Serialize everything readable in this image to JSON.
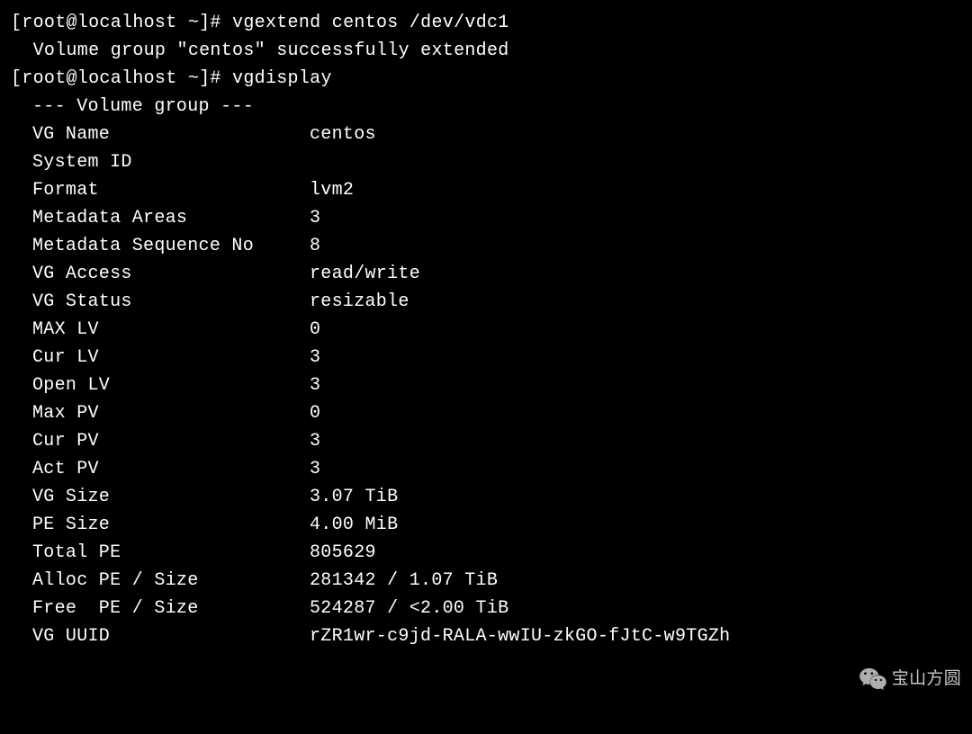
{
  "prompt1": "[root@localhost ~]# ",
  "command1": "vgextend centos /dev/vdc1",
  "output1": "  Volume group \"centos\" successfully extended",
  "prompt2": "[root@localhost ~]# ",
  "command2": "vgdisplay",
  "group_header": "--- Volume group ---",
  "kv": [
    {
      "k": "VG Name",
      "v": "centos"
    },
    {
      "k": "System ID",
      "v": ""
    },
    {
      "k": "Format",
      "v": "lvm2"
    },
    {
      "k": "Metadata Areas",
      "v": "3"
    },
    {
      "k": "Metadata Sequence No",
      "v": "8"
    },
    {
      "k": "VG Access",
      "v": "read/write"
    },
    {
      "k": "VG Status",
      "v": "resizable"
    },
    {
      "k": "MAX LV",
      "v": "0"
    },
    {
      "k": "Cur LV",
      "v": "3"
    },
    {
      "k": "Open LV",
      "v": "3"
    },
    {
      "k": "Max PV",
      "v": "0"
    },
    {
      "k": "Cur PV",
      "v": "3"
    },
    {
      "k": "Act PV",
      "v": "3"
    },
    {
      "k": "VG Size",
      "v": "3.07 TiB"
    },
    {
      "k": "PE Size",
      "v": "4.00 MiB"
    },
    {
      "k": "Total PE",
      "v": "805629"
    },
    {
      "k": "Alloc PE / Size",
      "v": "281342 / 1.07 TiB"
    },
    {
      "k": "Free  PE / Size",
      "v": "524287 / <2.00 TiB"
    },
    {
      "k": "VG UUID",
      "v": "rZR1wr-c9jd-RALA-wwIU-zkGO-fJtC-w9TGZh"
    }
  ],
  "watermark_text": "宝山方圆"
}
